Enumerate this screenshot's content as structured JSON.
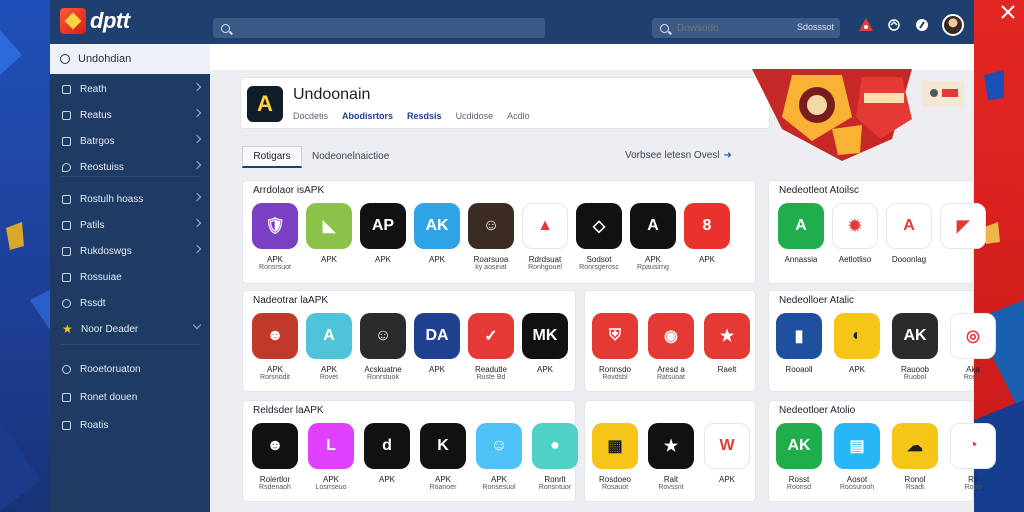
{
  "brand": {
    "logo_text": "dptt"
  },
  "topbar": {
    "search_placeholder": "",
    "small_search_placeholder": "Dowsodo",
    "small_search_hint": "Sdosssot"
  },
  "sidebar": {
    "header": "Undohdian",
    "items": [
      {
        "label": "Reath",
        "icon": "doc-icon",
        "chevron": "right"
      },
      {
        "label": "Reatus",
        "icon": "doc-icon",
        "chevron": "right"
      },
      {
        "label": "Batrgos",
        "icon": "doc-icon",
        "chevron": "right"
      },
      {
        "label": "Reostuiss",
        "icon": "pin-icon",
        "chevron": "right"
      },
      {
        "label": "Rostulh hoass",
        "icon": "doc-icon",
        "chevron": "right"
      },
      {
        "label": "Patils",
        "icon": "doc-icon",
        "chevron": "right"
      },
      {
        "label": "Rukdoswgs",
        "icon": "doc-icon",
        "chevron": "right"
      },
      {
        "label": "Rossuiae",
        "icon": "doc-icon",
        "chevron": ""
      },
      {
        "label": "Rssdt",
        "icon": "gear-icon",
        "chevron": ""
      },
      {
        "label": "Noor Deader",
        "icon": "star-icon",
        "chevron": "down"
      },
      {
        "label": "Rooetoruaton",
        "icon": "gear-icon",
        "chevron": ""
      },
      {
        "label": "Ronet douen",
        "icon": "doc-icon",
        "chevron": ""
      },
      {
        "label": "Roatis",
        "icon": "doc-icon",
        "chevron": ""
      }
    ]
  },
  "app": {
    "title": "Undoonain",
    "logo_letter": "A",
    "tabs": [
      {
        "label": "Docdetis",
        "active": false
      },
      {
        "label": "Abodisrtors",
        "active": true
      },
      {
        "label": "Resdsis",
        "active": true
      },
      {
        "label": "Ucdidose",
        "active": false
      },
      {
        "label": "Acdlo",
        "active": false
      }
    ]
  },
  "filters": {
    "active_pill": "Rotigars",
    "left_text": "Nodeonelnaictioe",
    "right_text": "Vorbsee letesn Ovesl"
  },
  "sections": [
    {
      "title": "Arrdolaor isAPK",
      "tiles": [
        {
          "l1": "APK",
          "l2": "Ronsrsuot",
          "color": "#7b3fc4",
          "glyph": "🛡"
        },
        {
          "l1": "APK",
          "l2": "",
          "color": "#8bc34a",
          "glyph": "◣"
        },
        {
          "l1": "APK",
          "l2": "",
          "color": "#111111",
          "glyph": "AP"
        },
        {
          "l1": "APK",
          "l2": "",
          "color": "#2ea3e6",
          "glyph": "AK"
        },
        {
          "l1": "Roarsuoa",
          "l2": "ky aosinat",
          "color": "#3b2b22",
          "glyph": "☺"
        },
        {
          "l1": "Rdrdsuat",
          "l2": "Ronhgouel",
          "color": "#ffffff",
          "glyph": "▲"
        },
        {
          "l1": "Sodsot",
          "l2": "Ronrsgerosc",
          "color": "#111111",
          "glyph": "◇"
        },
        {
          "l1": "APK",
          "l2": "Rpausirng",
          "color": "#111111",
          "glyph": "A"
        },
        {
          "l1": "APK",
          "l2": "",
          "color": "#e8322b",
          "glyph": "8"
        }
      ]
    },
    {
      "title": "Nedeotleot Atoilsc",
      "tiles": [
        {
          "l1": "Annassia",
          "l2": "",
          "color": "#1fae4b",
          "glyph": "A"
        },
        {
          "l1": "Aetlotliso",
          "l2": "",
          "color": "#ffffff",
          "glyph": "✹"
        },
        {
          "l1": "Dooonlag",
          "l2": "",
          "color": "#ffffff",
          "glyph": "A"
        },
        {
          "l1": "",
          "l2": "",
          "color": "#ffffff",
          "glyph": "◤"
        }
      ]
    },
    {
      "title": "Nadeotrar laAPK",
      "tiles": [
        {
          "l1": "APK",
          "l2": "Rorsnodit",
          "color": "#c0392b",
          "glyph": "☻"
        },
        {
          "l1": "APK",
          "l2": "Rovet",
          "color": "#4fc3d9",
          "glyph": "A"
        },
        {
          "l1": "Acskuatne",
          "l2": "Ronrstuok",
          "color": "#2b2b2b",
          "glyph": "☺"
        },
        {
          "l1": "APK",
          "l2": "",
          "color": "#1f3f8f",
          "glyph": "DA"
        },
        {
          "l1": "Readutle",
          "l2": "Ruste Bd",
          "color": "#e53935",
          "glyph": "✓"
        },
        {
          "l1": "APK",
          "l2": "",
          "color": "#111111",
          "glyph": "MK"
        }
      ]
    },
    {
      "title": "",
      "tiles": [
        {
          "l1": "Ronnsdo",
          "l2": "Rovdsbl",
          "color": "#e53935",
          "glyph": "⛨"
        },
        {
          "l1": "Aresd a",
          "l2": "Ratsuoat",
          "color": "#e53935",
          "glyph": "◉"
        },
        {
          "l1": "Raelt",
          "l2": "",
          "color": "#e53935",
          "glyph": "★"
        }
      ]
    },
    {
      "title": "Nedeolloer Atalic",
      "tiles": [
        {
          "l1": "Rooaoll",
          "l2": "",
          "color": "#1f4f9f",
          "glyph": "▮"
        },
        {
          "l1": "APK",
          "l2": "",
          "color": "#f5c518",
          "glyph": "◐"
        },
        {
          "l1": "Rauoob",
          "l2": "Ruobol",
          "color": "#2b2b2b",
          "glyph": "AK"
        },
        {
          "l1": "Aka",
          "l2": "Rosdt",
          "color": "#ffffff",
          "glyph": "◎"
        }
      ]
    },
    {
      "title": "Reldsder laAPK",
      "tiles": [
        {
          "l1": "Rolertlor",
          "l2": "Rsdenaoh",
          "color": "#111111",
          "glyph": "☻"
        },
        {
          "l1": "APK",
          "l2": "Losrrseuo",
          "color": "#e040fb",
          "glyph": "L"
        },
        {
          "l1": "APK",
          "l2": "",
          "color": "#111111",
          "glyph": "d"
        },
        {
          "l1": "APK",
          "l2": "Roanoer",
          "color": "#111111",
          "glyph": "K"
        },
        {
          "l1": "APK",
          "l2": "Ronsesuol",
          "color": "#4fc3f7",
          "glyph": "☺"
        },
        {
          "l1": "Ronrlt",
          "l2": "Ronsntuor",
          "color": "#4fd1c5",
          "glyph": "●"
        }
      ]
    },
    {
      "title": "",
      "tiles": [
        {
          "l1": "Rosdoeo",
          "l2": "Rosauot",
          "color": "#f5c518",
          "glyph": "▦"
        },
        {
          "l1": "Ralt",
          "l2": "Rovssnt",
          "color": "#111111",
          "glyph": "★"
        },
        {
          "l1": "APK",
          "l2": "",
          "color": "#ffffff",
          "glyph": "W"
        }
      ]
    },
    {
      "title": "Nedeotloer Atolio",
      "tiles": [
        {
          "l1": "Rosst",
          "l2": "Roonsd",
          "color": "#1fae4b",
          "glyph": "AK"
        },
        {
          "l1": "Aosot",
          "l2": "Roosurooh",
          "color": "#29b6f6",
          "glyph": "▤"
        },
        {
          "l1": "Ronol",
          "l2": "Rsadt",
          "color": "#f5c518",
          "glyph": "☁"
        },
        {
          "l1": "Rs",
          "l2": "Rooo",
          "color": "#ffffff",
          "glyph": "◔"
        }
      ]
    }
  ]
}
